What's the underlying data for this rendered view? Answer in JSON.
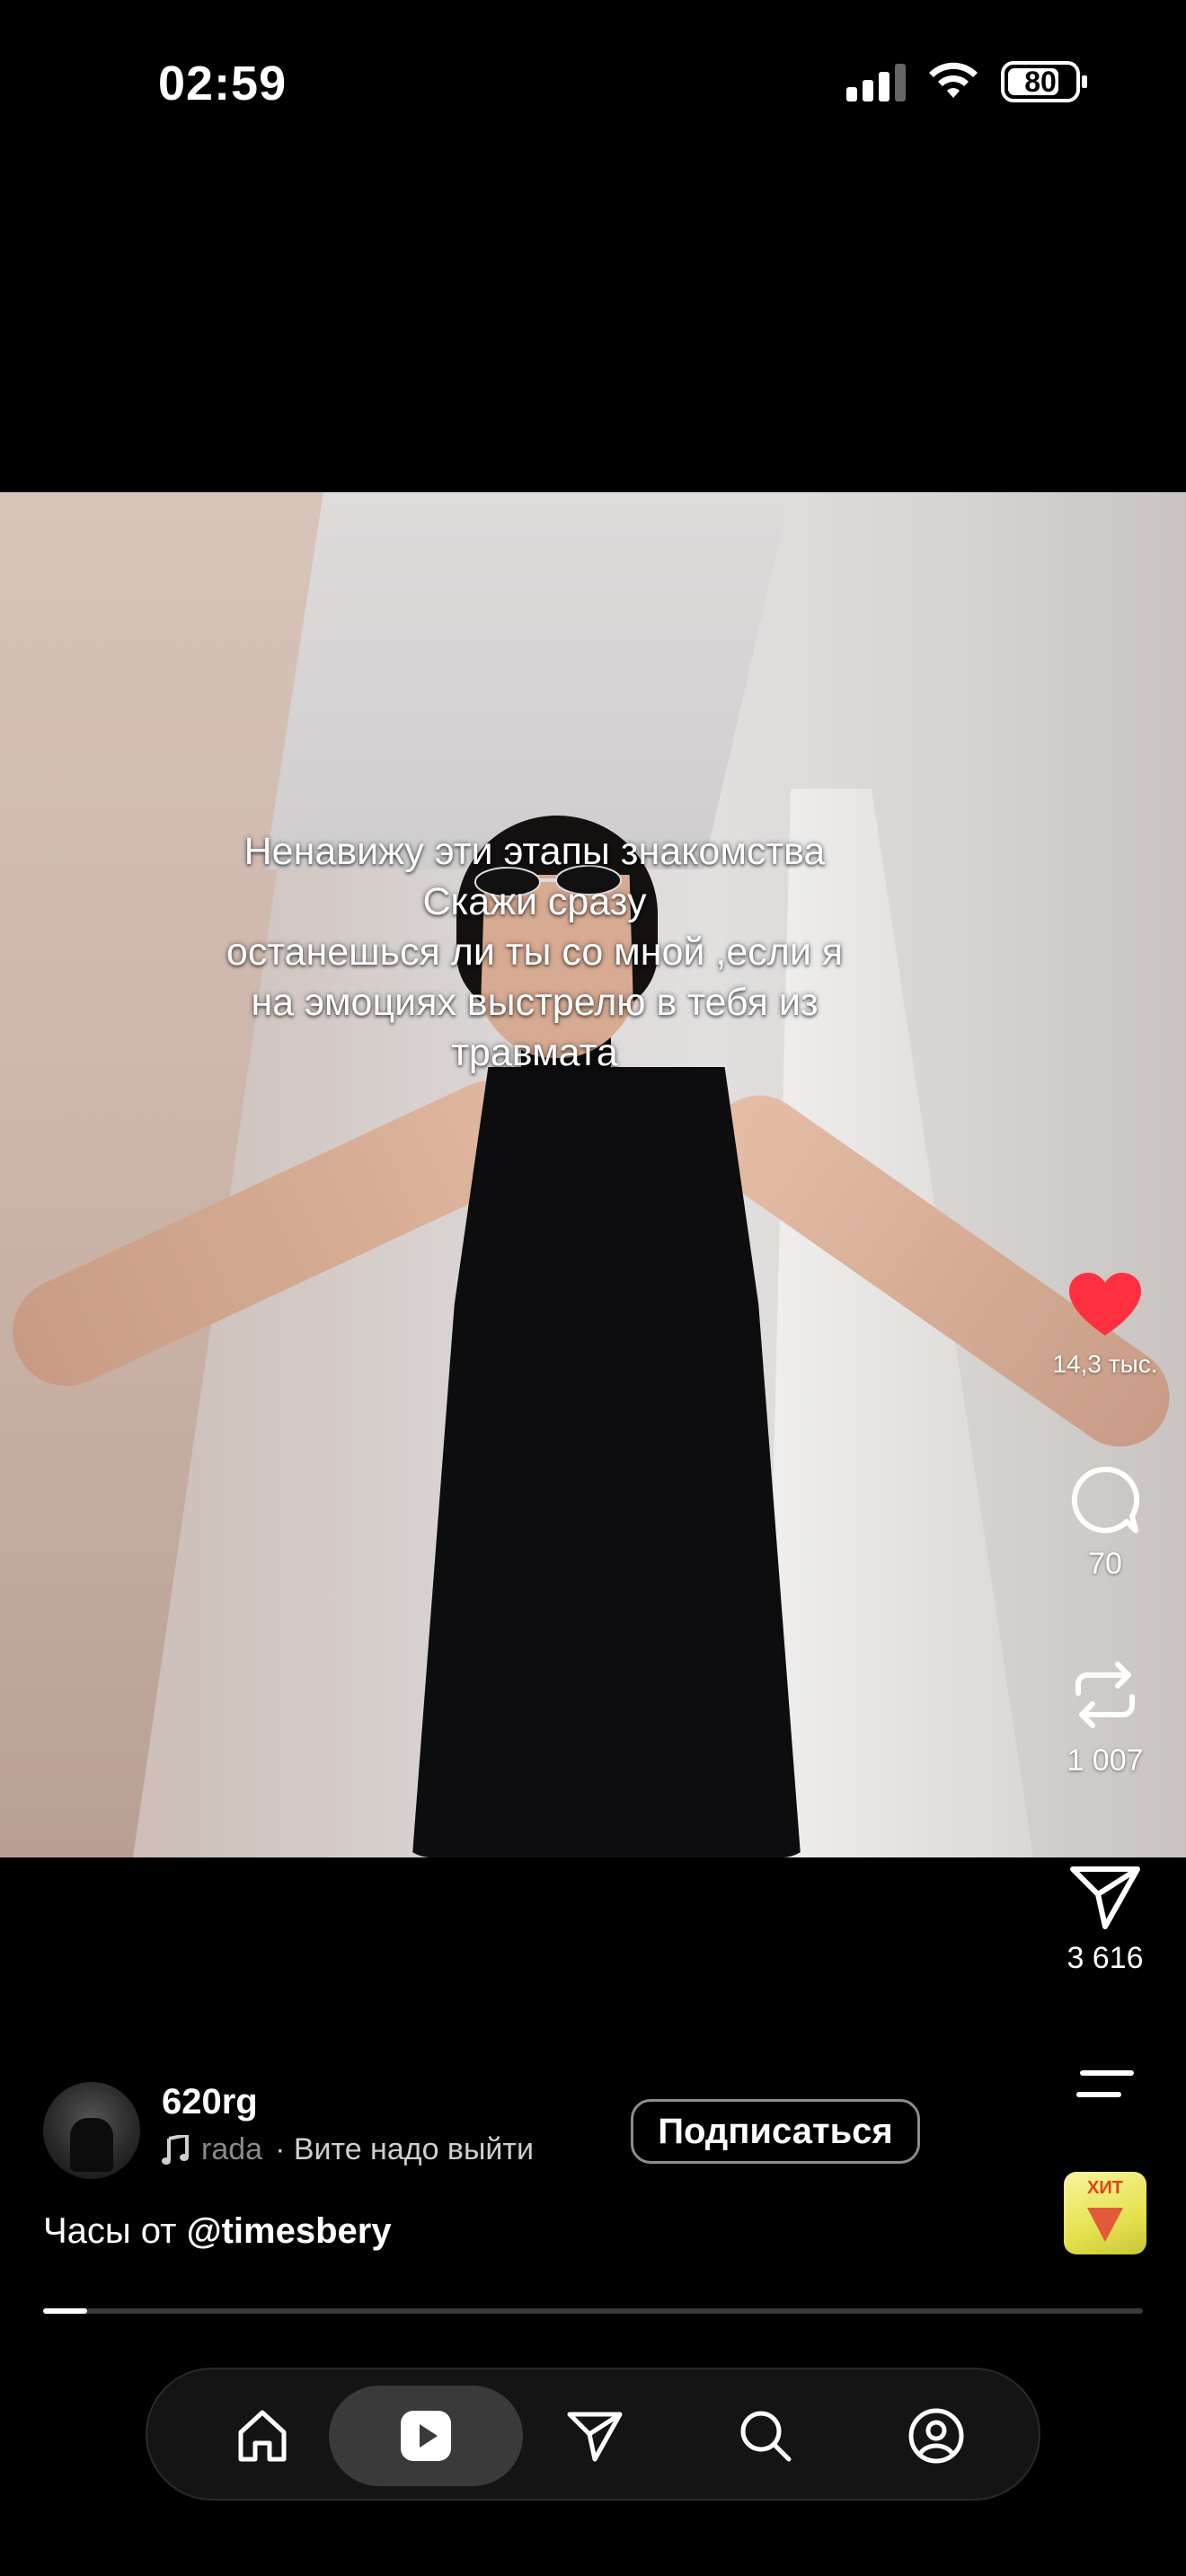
{
  "status_bar": {
    "time": "02:59",
    "battery": "80"
  },
  "video": {
    "caption_lines": [
      "Ненавижу эти этапы знакомства",
      "Скажи сразу",
      "останешься ли ты со мной ,если я",
      "на эмоциях выстрелю в тебя из",
      "травмата"
    ]
  },
  "actions": {
    "likes": "14,3 тыс.",
    "comments": "70",
    "reposts": "1 007",
    "shares": "3 616",
    "like_color": "#ff3040"
  },
  "author": {
    "username": "620rg",
    "music_faded": "rada",
    "music_track": "· Вите надо выйти",
    "follow_label": "Подписаться"
  },
  "description": {
    "prefix": "Часы от ",
    "mention": "@timesbery"
  },
  "album_art": {
    "text": "ХИТ"
  },
  "progress": {
    "fraction": 0.04
  },
  "nav": {
    "items": [
      "home",
      "reels",
      "direct",
      "search",
      "profile"
    ],
    "active": "reels"
  }
}
